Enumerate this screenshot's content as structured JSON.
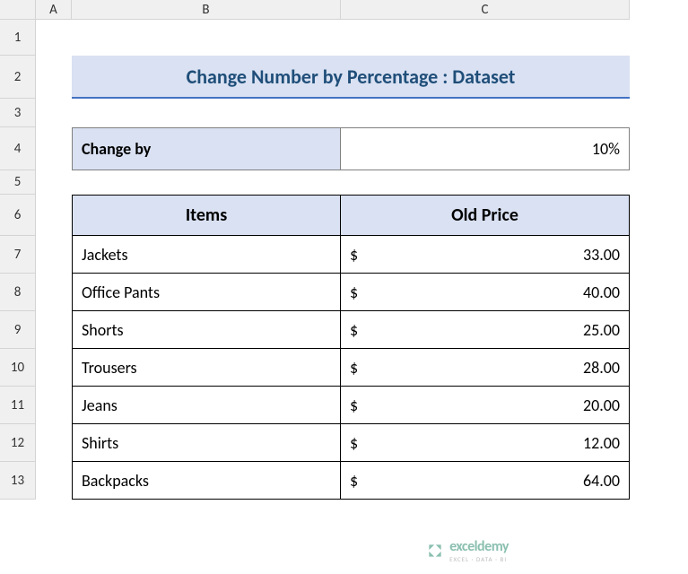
{
  "columns": {
    "A": "A",
    "B": "B",
    "C": "C"
  },
  "rows": [
    "1",
    "2",
    "3",
    "4",
    "5",
    "6",
    "7",
    "8",
    "9",
    "10",
    "11",
    "12",
    "13"
  ],
  "title": "Change Number by Percentage : Dataset",
  "change_by": {
    "label": "Change by",
    "value": "10%"
  },
  "table": {
    "headers": {
      "items": "Items",
      "price": "Old Price"
    },
    "currency": "$",
    "rows": [
      {
        "item": "Jackets",
        "price": "33.00"
      },
      {
        "item": "Office Pants",
        "price": "40.00"
      },
      {
        "item": "Shorts",
        "price": "25.00"
      },
      {
        "item": "Trousers",
        "price": "28.00"
      },
      {
        "item": "Jeans",
        "price": "20.00"
      },
      {
        "item": "Shirts",
        "price": "12.00"
      },
      {
        "item": "Backpacks",
        "price": "64.00"
      }
    ]
  },
  "watermark": {
    "main": "exceldemy",
    "sub": "EXCEL · DATA · BI"
  }
}
